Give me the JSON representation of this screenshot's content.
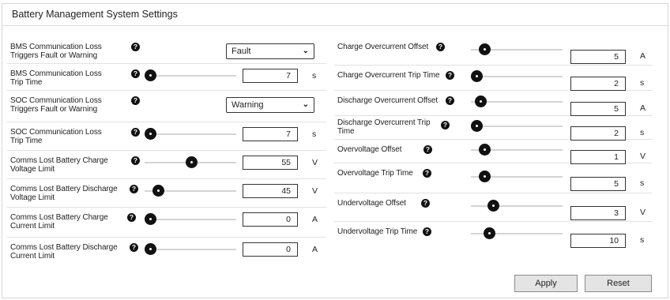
{
  "title": "Battery Management System Settings",
  "left": [
    {
      "label": [
        "BMS Communication Loss",
        "Triggers Fault or Warning"
      ],
      "select": "Fault"
    },
    {
      "label": [
        "BMS Communication Loss",
        "Trip Time"
      ],
      "value": "7",
      "unit": "s",
      "level": 0.0
    },
    {
      "label": [
        "SOC Communication Loss",
        "Triggers Fault or Warning"
      ],
      "select": "Warning"
    },
    {
      "label": [
        "SOC Communication Loss",
        "Trip Time"
      ],
      "value": "7",
      "unit": "s",
      "level": 0.0
    },
    {
      "label": [
        "Comms Lost Battery Charge",
        "Voltage Limit"
      ],
      "value": "55",
      "unit": "V",
      "level": 0.5
    },
    {
      "label": [
        "Comms Lost Battery Discharge",
        "Voltage Limit"
      ],
      "value": "45",
      "unit": "V",
      "level": 0.1
    },
    {
      "label": [
        "Comms Lost Battery Charge",
        "Current Limit"
      ],
      "value": "0",
      "unit": "A",
      "level": 0.0
    },
    {
      "label": [
        "Comms Lost Battery Discharge",
        "Current Limit"
      ],
      "value": "0",
      "unit": "A",
      "level": 0.0
    }
  ],
  "right": [
    {
      "label": [
        "Charge Overcurrent Offset"
      ],
      "value": "5",
      "unit": "A",
      "level": 0.1
    },
    {
      "label": [
        "Charge Overcurrent Trip Time"
      ],
      "value": "2",
      "unit": "s",
      "level": 0.0
    },
    {
      "label": [
        "Discharge Overcurrent Offset"
      ],
      "value": "5",
      "unit": "A",
      "level": 0.05
    },
    {
      "label": [
        "Discharge Overcurrent Trip",
        "Time"
      ],
      "value": "2",
      "unit": "s",
      "level": 0.0
    },
    {
      "label": [
        "Overvoltage Offset"
      ],
      "value": "1",
      "unit": "V",
      "level": 0.1
    },
    {
      "label": [
        "Overvoltage Trip Time"
      ],
      "value": "5",
      "unit": "s",
      "level": 0.1
    },
    {
      "label": [
        "Undervoltage Offset"
      ],
      "value": "3",
      "unit": "V",
      "level": 0.2
    },
    {
      "label": [
        "Undervoltage Trip Time"
      ],
      "value": "10",
      "unit": "s",
      "level": 0.15
    }
  ],
  "help_glyph": "?",
  "select_chevron": "⌄",
  "buttons": {
    "apply": "Apply",
    "reset": "Reset"
  }
}
